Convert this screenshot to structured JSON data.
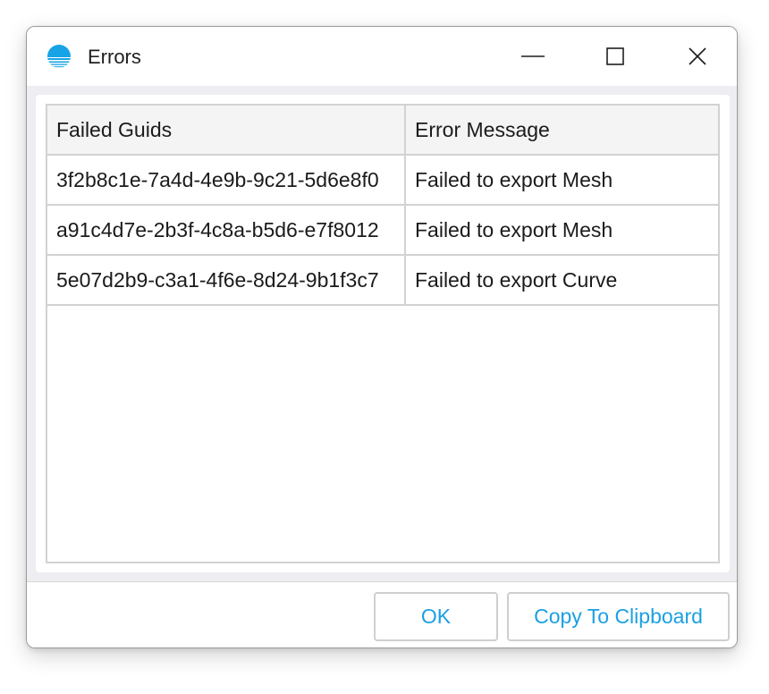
{
  "window": {
    "title": "Errors",
    "icon": "globe-stripes-icon"
  },
  "title_controls": {
    "minimize": "minimize-icon",
    "maximize": "maximize-icon",
    "close": "close-icon"
  },
  "table": {
    "columns": [
      "Failed Guids",
      "Error Message"
    ],
    "rows": [
      [
        "3f2b8c1e-7a4d-4e9b-9c21-5d6e8f0",
        "Failed to export Mesh"
      ],
      [
        "a91c4d7e-2b3f-4c8a-b5d6-e7f8012",
        "Failed to export Mesh"
      ],
      [
        "5e07d2b9-c3a1-4f6e-8d24-9b1f3c7",
        "Failed to export Curve"
      ]
    ]
  },
  "buttons": {
    "ok": "OK",
    "copy": "Copy To Clipboard"
  },
  "colors": {
    "accent": "#1ba0e2",
    "icon_blue": "#18a3e6"
  }
}
